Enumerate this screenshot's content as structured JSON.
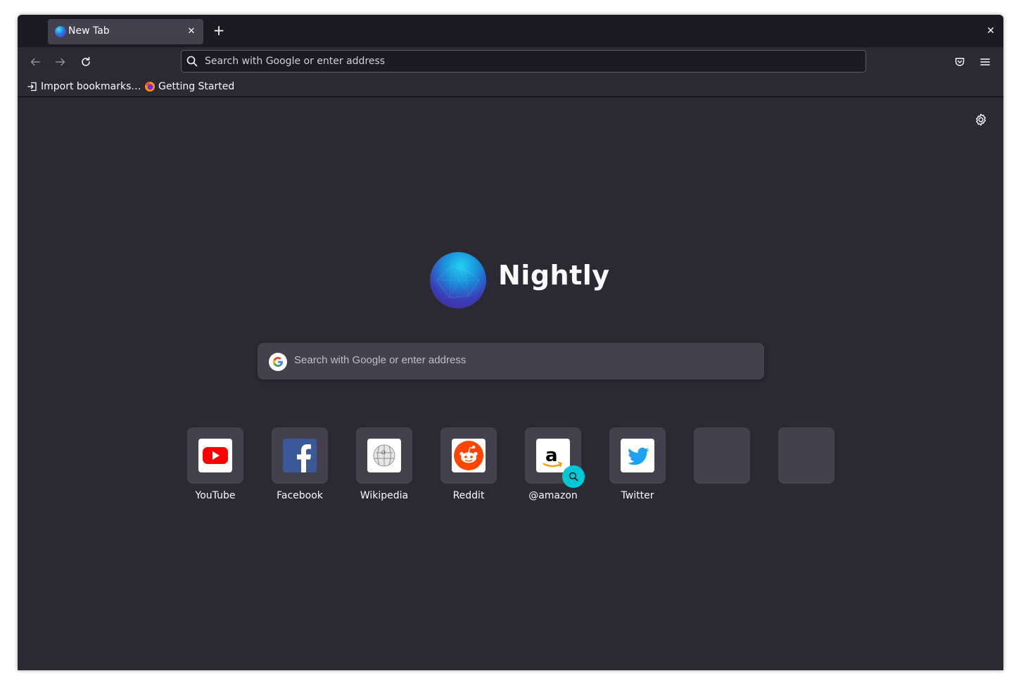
{
  "tab": {
    "title": "New Tab",
    "close_glyph": "✕"
  },
  "toolbar": {
    "new_tab_glyph": "+",
    "window_close_glyph": "✕",
    "url_placeholder": "Search with Google or enter address"
  },
  "bookmarks": [
    {
      "label": "Import bookmarks…",
      "icon": "import-icon"
    },
    {
      "label": "Getting Started",
      "icon": "firefox-icon"
    }
  ],
  "brand": {
    "name": "Nightly"
  },
  "search": {
    "placeholder": "Search with Google or enter address"
  },
  "top_sites": [
    {
      "label": "YouTube",
      "icon": "youtube-icon"
    },
    {
      "label": "Facebook",
      "icon": "facebook-icon"
    },
    {
      "label": "Wikipedia",
      "icon": "wikipedia-icon"
    },
    {
      "label": "Reddit",
      "icon": "reddit-icon"
    },
    {
      "label": "@amazon",
      "icon": "amazon-icon"
    },
    {
      "label": "Twitter",
      "icon": "twitter-icon"
    },
    {
      "label": "",
      "icon": ""
    },
    {
      "label": "",
      "icon": ""
    }
  ],
  "colors": {
    "background": "#2b2a33",
    "tabstrip": "#1c1b22",
    "tile": "#42414d",
    "accent_badge": "#00c8d7"
  }
}
